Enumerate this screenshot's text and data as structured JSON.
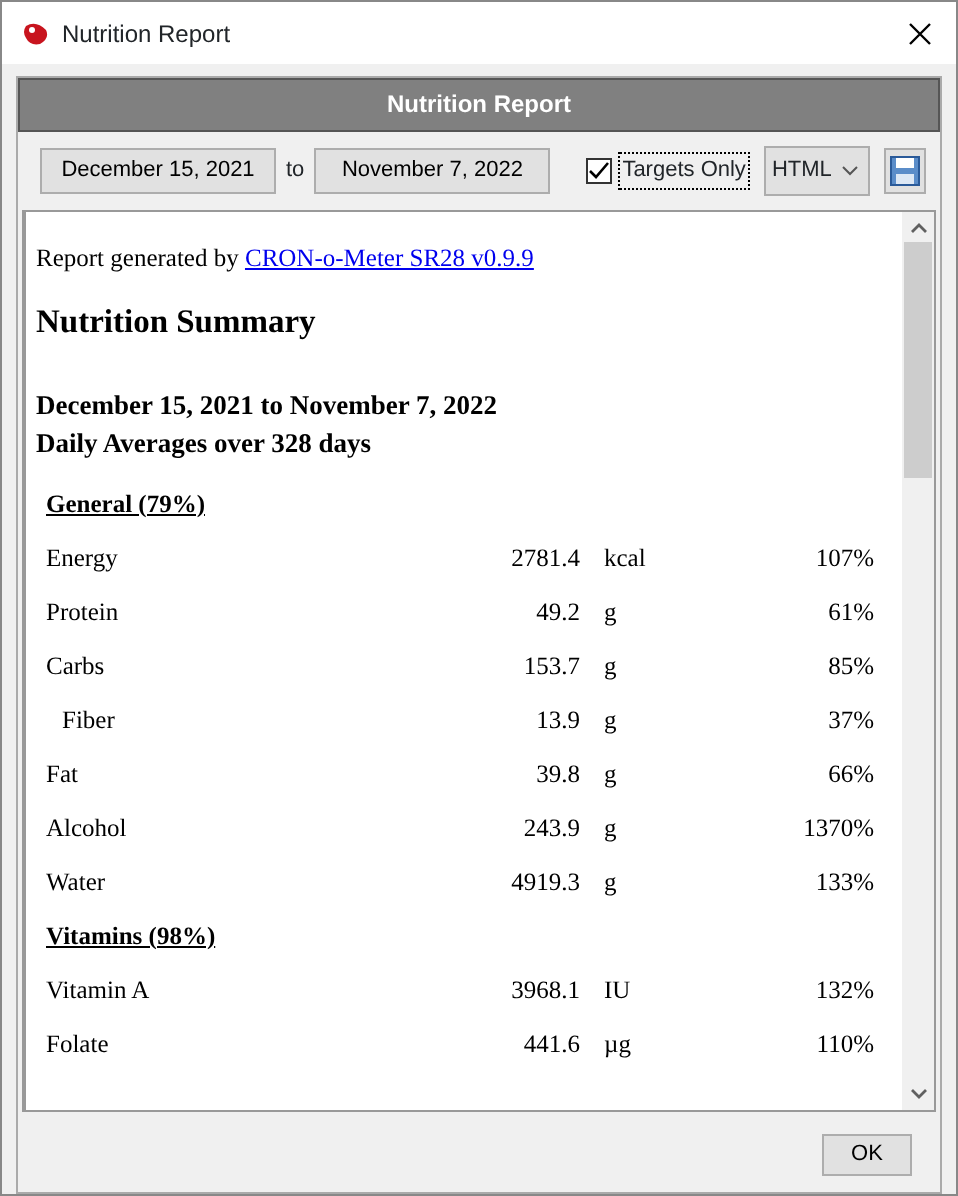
{
  "window": {
    "title": "Nutrition Report"
  },
  "header": "Nutrition Report",
  "toolbar": {
    "start_date": "December 15, 2021",
    "separator": "to",
    "end_date": "November 7, 2022",
    "targets_only": {
      "label": "Targets Only",
      "checked": true
    },
    "format": "HTML"
  },
  "report": {
    "generated_by": "Report generated by",
    "generator_link": "CRON-o-Meter SR28 v0.9.9",
    "title": "Nutrition Summary",
    "date_range": "December 15, 2021 to November 7, 2022",
    "averages": "Daily Averages over 328 days",
    "rows": [
      {
        "kind": "heading",
        "label": "General (79%)"
      },
      {
        "kind": "nutrient",
        "name": "Energy",
        "amount": "2781.4",
        "unit": "kcal",
        "percent": "107%"
      },
      {
        "kind": "nutrient",
        "name": "Protein",
        "amount": "49.2",
        "unit": "g",
        "percent": "61%"
      },
      {
        "kind": "nutrient",
        "name": "Carbs",
        "amount": "153.7",
        "unit": "g",
        "percent": "85%"
      },
      {
        "kind": "subnutrient",
        "name": "Fiber",
        "amount": "13.9",
        "unit": "g",
        "percent": "37%"
      },
      {
        "kind": "nutrient",
        "name": "Fat",
        "amount": "39.8",
        "unit": "g",
        "percent": "66%"
      },
      {
        "kind": "nutrient",
        "name": "Alcohol",
        "amount": "243.9",
        "unit": "g",
        "percent": "1370%"
      },
      {
        "kind": "nutrient",
        "name": "Water",
        "amount": "4919.3",
        "unit": "g",
        "percent": "133%"
      },
      {
        "kind": "heading",
        "label": "Vitamins (98%)"
      },
      {
        "kind": "nutrient",
        "name": "Vitamin A",
        "amount": "3968.1",
        "unit": "IU",
        "percent": "132%"
      },
      {
        "kind": "nutrient",
        "name": "Folate",
        "amount": "441.6",
        "unit": "µg",
        "percent": "110%"
      }
    ]
  },
  "buttons": [
    "OK"
  ]
}
